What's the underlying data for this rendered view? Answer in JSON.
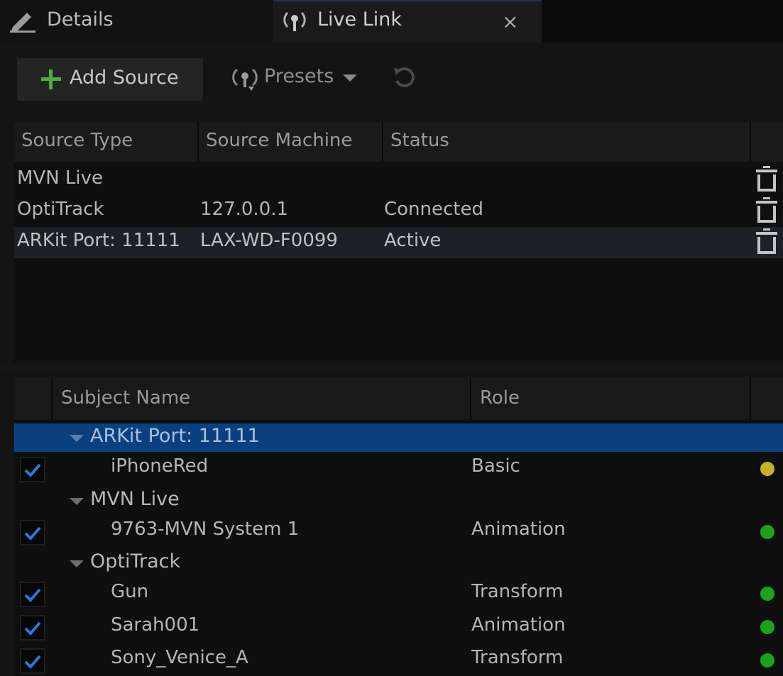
{
  "tabs": {
    "details_label": "Details",
    "livelink_label": "Live Link",
    "close_glyph": "×"
  },
  "toolbar": {
    "add_source_label": "Add Source",
    "presets_label": "Presets"
  },
  "sources": {
    "columns": [
      "Source Type",
      "Source Machine",
      "Status"
    ],
    "rows": [
      {
        "type": "MVN Live",
        "machine": "",
        "status": ""
      },
      {
        "type": "OptiTrack",
        "machine": "127.0.0.1",
        "status": "Connected"
      },
      {
        "type": "ARKit Port: 11111",
        "machine": "LAX-WD-F0099",
        "status": "Active"
      }
    ]
  },
  "subjects": {
    "columns": [
      "Subject Name",
      "Role"
    ],
    "groups": [
      {
        "name": "ARKit Port: 11111",
        "items": [
          {
            "name": "iPhoneRed",
            "role": "Basic",
            "status_color": "#c4b32a"
          }
        ]
      },
      {
        "name": "MVN Live",
        "items": [
          {
            "name": "9763-MVN System 1",
            "role": "Animation",
            "status_color": "#1aa31a"
          }
        ]
      },
      {
        "name": "OptiTrack",
        "items": [
          {
            "name": "Gun",
            "role": "Transform",
            "status_color": "#1aa31a"
          },
          {
            "name": "Sarah001",
            "role": "Animation",
            "status_color": "#1aa31a"
          },
          {
            "name": "Sony_Venice_A",
            "role": "Transform",
            "status_color": "#1aa31a"
          }
        ]
      }
    ]
  },
  "colors": {
    "selection_blue": "#0b4080",
    "status_green": "#1aa31a",
    "status_yellow": "#c4b32a",
    "add_plus_green": "#4caf3a",
    "check_blue": "#2f78d8"
  }
}
